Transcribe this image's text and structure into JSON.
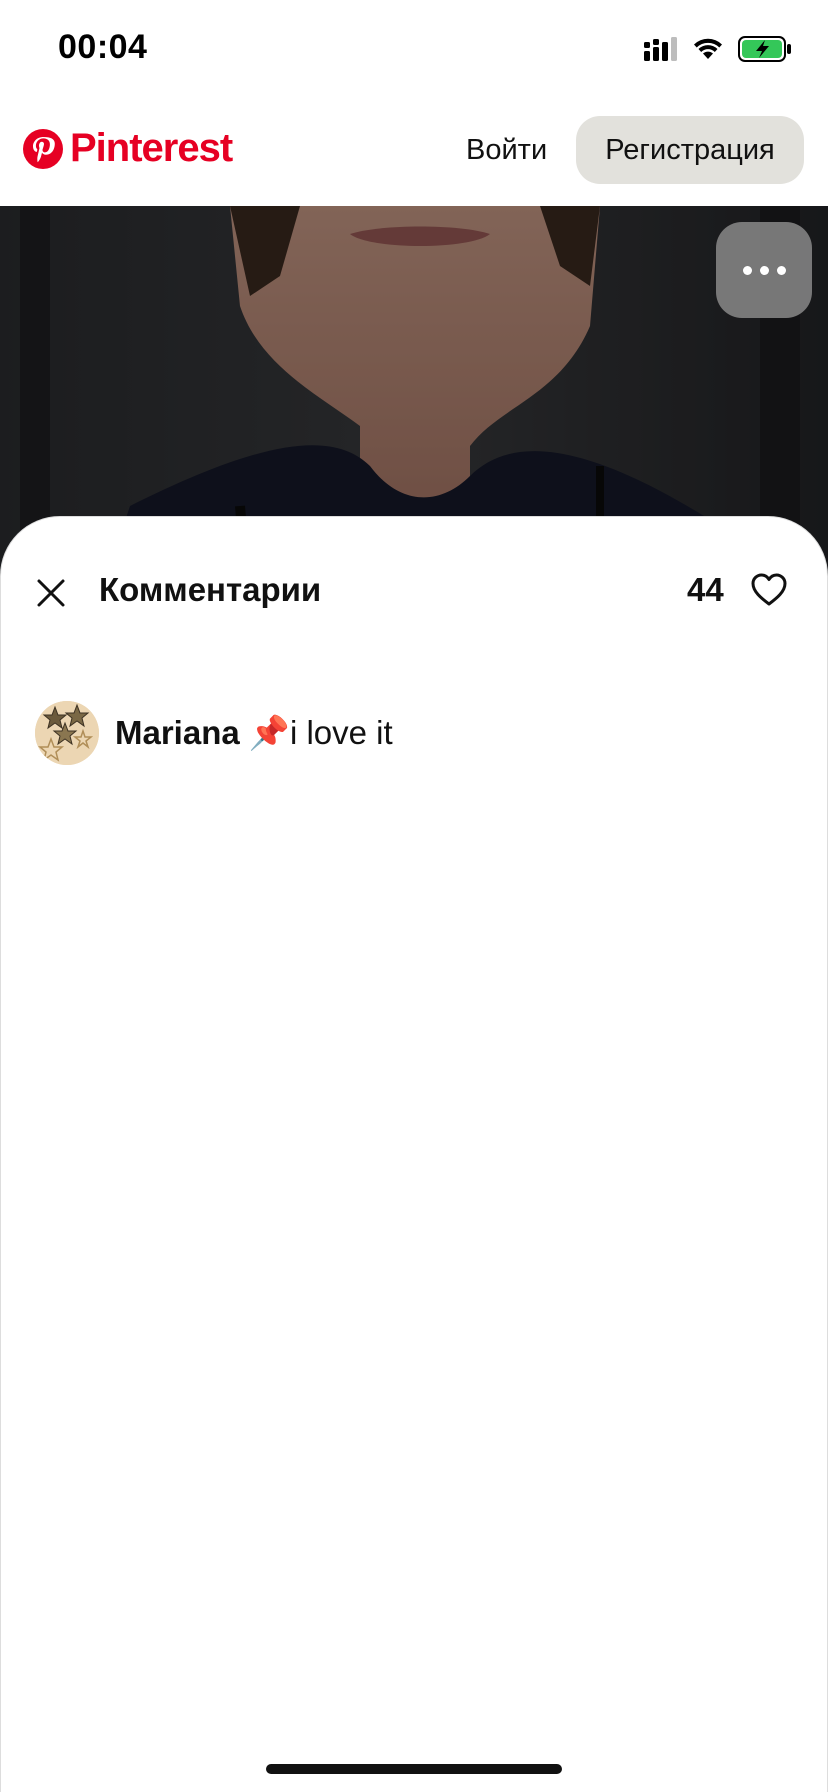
{
  "status_bar": {
    "time": "00:04",
    "icons": [
      "cellular-signal-icon",
      "wifi-icon",
      "battery-charging-icon"
    ]
  },
  "header": {
    "logo_text": "Pinterest",
    "login_label": "Войти",
    "signup_label": "Регистрация",
    "brand_color": "#e60023"
  },
  "photo": {
    "more_icon": "more-horizontal-icon"
  },
  "comments_sheet": {
    "close_icon": "close-icon",
    "title": "Комментарии",
    "likes_count": "44",
    "heart_icon": "heart-icon",
    "comments": [
      {
        "author": "Mariana",
        "text": " 📌i love it",
        "avatar_icon": "stars-avatar"
      }
    ]
  }
}
